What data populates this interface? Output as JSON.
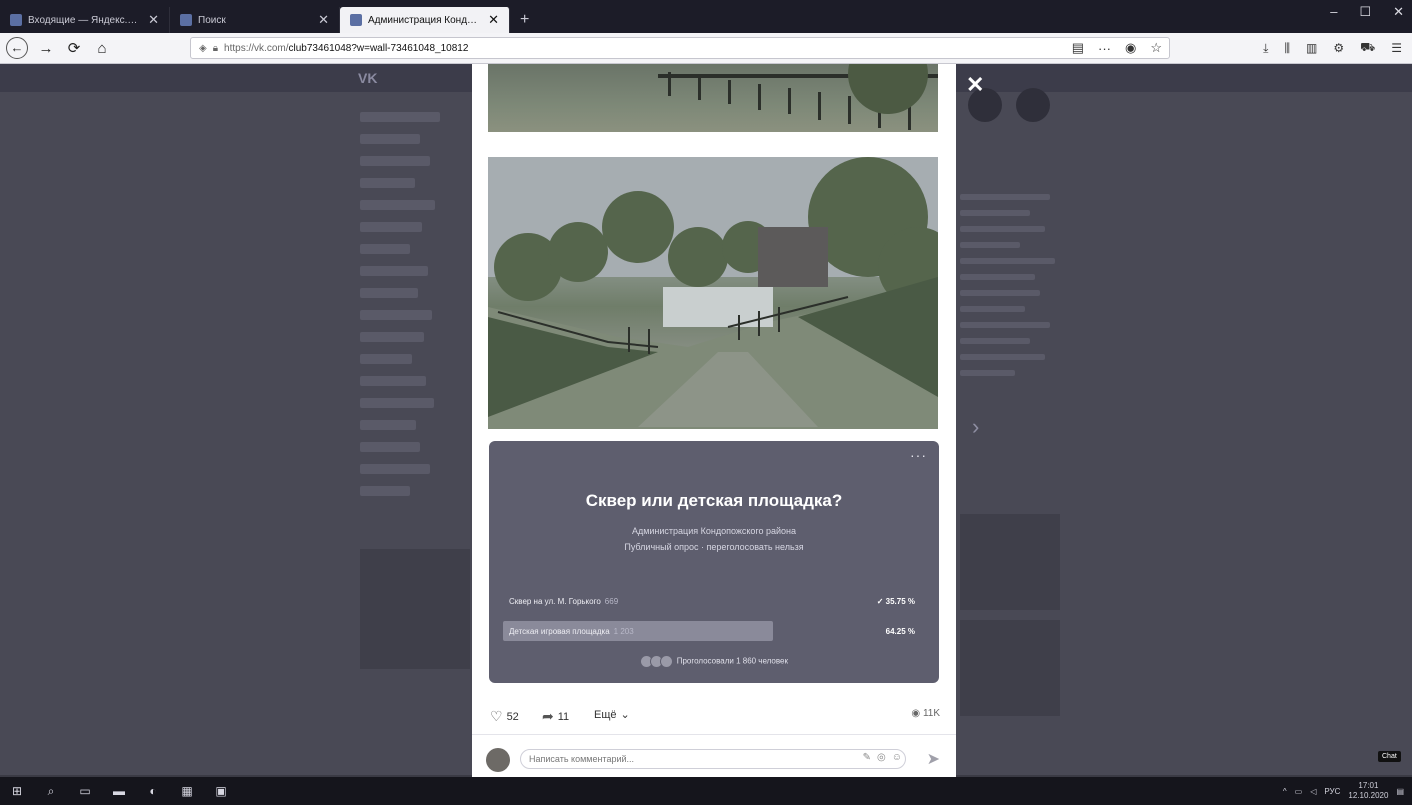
{
  "browser": {
    "tabs": [
      {
        "label": "Входящие — Яндекс.Почта",
        "close": "✕",
        "active": false
      },
      {
        "label": "Поиск",
        "close": "✕",
        "active": false
      },
      {
        "label": "Администрация Кондопожск",
        "close": "✕",
        "active": true
      }
    ],
    "new_tab": "+",
    "url_host": "https://vk.com/",
    "url_path": "club73461048?w=wall-73461048_10812",
    "window_controls": [
      "–",
      "☐",
      "✕"
    ]
  },
  "page": {
    "vk_logo": "VK"
  },
  "post": {
    "poll": {
      "question": "Сквер или детская площадка?",
      "author": "Администрация Кондопожского района",
      "type": "Публичный опрос · переголосовать нельзя",
      "options": [
        {
          "label": "Сквер на ул. М. Горького",
          "count": "669",
          "percent": "35.75 %",
          "voted_mark": "✓",
          "fraction": 0.3575
        },
        {
          "label": "Детская игровая площадка",
          "count": "1 203",
          "percent": "64.25 %",
          "voted_mark": "",
          "fraction": 0.6425
        }
      ],
      "voters_text": "Проголосовали 1 860 человек",
      "menu": "···"
    },
    "likes": "52",
    "shares": "11",
    "more_label": "Ещё",
    "views": "11K",
    "comment_placeholder": "Написать комментарий..."
  },
  "taskbar": {
    "language": "РУС",
    "time": "17:01",
    "date": "12.10.2020",
    "chat_badge": "Chat"
  },
  "colors": {
    "poll_bg": "#5e5e6e",
    "winning_bar": "#8a8a9a",
    "dim_overlay": "#494955"
  }
}
